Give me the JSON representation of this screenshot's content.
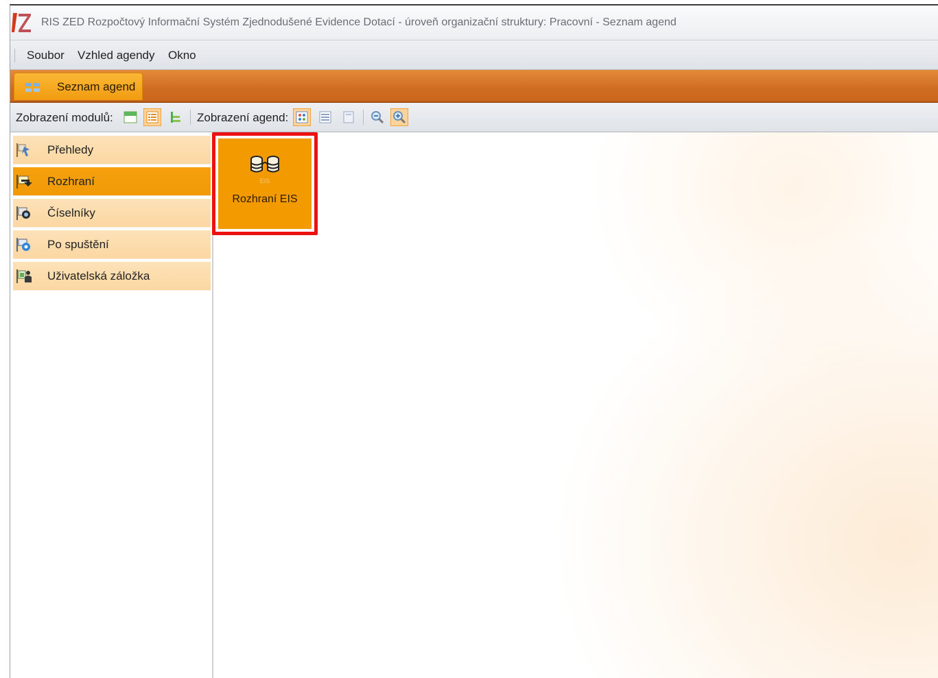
{
  "window": {
    "title": "RIS ZED Rozpočtový Informační Systém Zjednodušené Evidence Dotací - úroveň organizační struktury: Pracovní - Seznam agend"
  },
  "menu": {
    "items": [
      "Soubor",
      "Vzhled agendy",
      "Okno"
    ]
  },
  "tabs": [
    {
      "label": "Seznam agend",
      "icon": "agenda-list-icon",
      "active": true
    }
  ],
  "toolbar": {
    "modules_label": "Zobrazení modulů:",
    "agendas_label": "Zobrazení agend:"
  },
  "sidebar": {
    "items": [
      {
        "label": "Přehledy",
        "icon": "overview-icon",
        "active": false
      },
      {
        "label": "Rozhraní",
        "icon": "interface-icon",
        "active": true
      },
      {
        "label": "Číselníky",
        "icon": "codebook-icon",
        "active": false
      },
      {
        "label": "Po spuštění",
        "icon": "startup-icon",
        "active": false
      },
      {
        "label": "Uživatelská záložka",
        "icon": "user-tab-icon",
        "active": false
      }
    ]
  },
  "agendas": [
    {
      "label": "Rozhraní EIS",
      "icon": "database-link-icon",
      "icon_caption": "EIS",
      "highlighted": true
    }
  ],
  "colors": {
    "accent_orange": "#f29a00",
    "tab_strip": "#d5732a",
    "highlight_red": "#ec1212",
    "sidebar_item": "#fcdcab"
  }
}
